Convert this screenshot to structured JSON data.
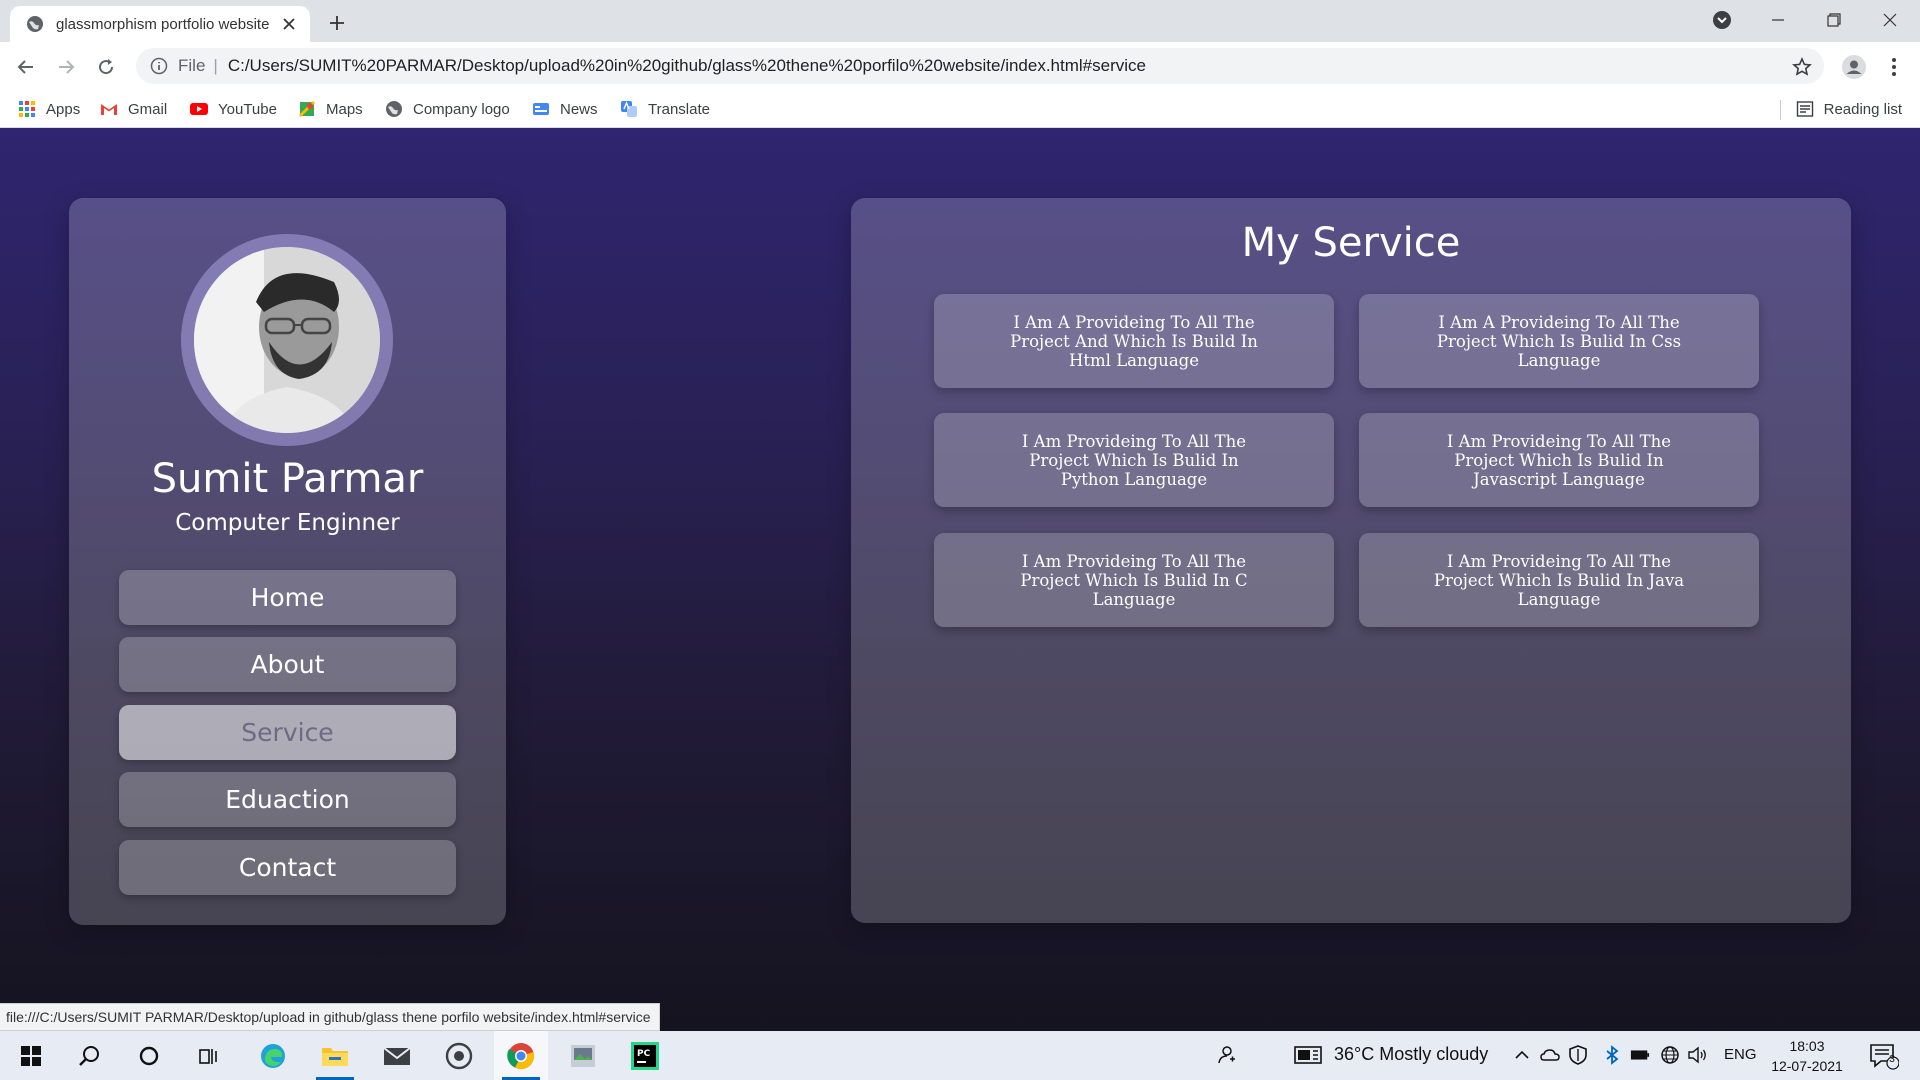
{
  "browser": {
    "tab_title": "glassmorphism portfolio website",
    "omnibox_scheme": "File",
    "omnibox_url": "C:/Users/SUMIT%20PARMAR/Desktop/upload%20in%20github/glass%20thene%20porfilo%20website/index.html#service",
    "bookmarks": [
      "Apps",
      "Gmail",
      "YouTube",
      "Maps",
      "Company logo",
      "News",
      "Translate"
    ],
    "reading_list": "Reading list",
    "status_url": "file:///C:/Users/SUMIT PARMAR/Desktop/upload in github/glass thene porfilo website/index.html#service"
  },
  "profile": {
    "name": "Sumit Parmar",
    "role": "Computer Enginner",
    "menu": [
      "Home",
      "About",
      "Service",
      "Eduaction",
      "Contact"
    ],
    "active_menu": "Service"
  },
  "services": {
    "title": "My Service",
    "items": [
      "I Am A Provideing To All The Project And Which Is Build In Html Language",
      "I Am A Provideing To All The Project Which Is Bulid In Css Language",
      "I Am Provideing To All The Project Which Is Bulid In Python Language",
      "I Am Provideing To All The Project Which Is Bulid In Javascript Language",
      "I Am Provideing To All The Project Which Is Bulid In C Language",
      "I Am Provideing To All The Project Which Is Bulid In Java Language"
    ]
  },
  "taskbar": {
    "weather": "36°C  Mostly cloudy",
    "language": "ENG",
    "time": "18:03",
    "date": "12-07-2021",
    "notifications": "3"
  },
  "colors": {
    "page_top": "#2f2570",
    "page_bottom": "#15131f",
    "glass": "rgba(255,255,255,0.20)"
  }
}
